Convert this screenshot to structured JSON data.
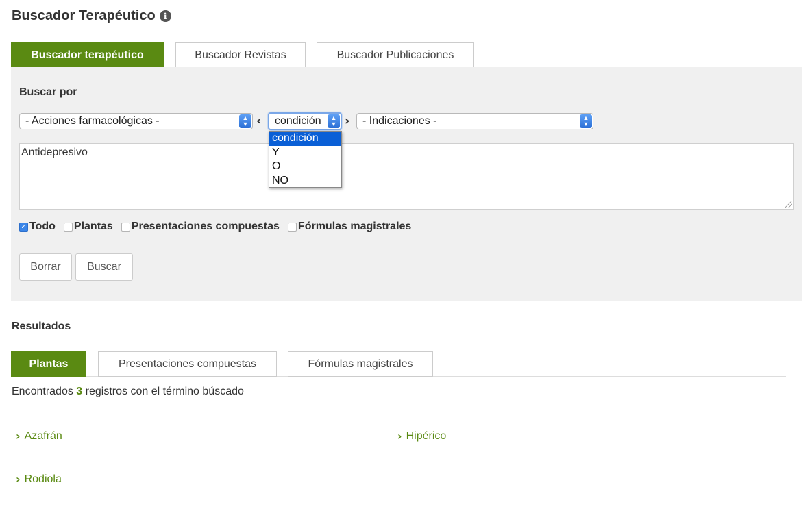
{
  "header": {
    "title": "Buscador Terapéutico",
    "info_icon_glyph": "i"
  },
  "top_tabs": [
    {
      "label": "Buscador terapéutico",
      "active": true
    },
    {
      "label": "Buscador Revistas",
      "active": false
    },
    {
      "label": "Buscador Publicaciones",
      "active": false
    }
  ],
  "search": {
    "label": "Buscar por",
    "select_actions": "- Acciones farmacológicas -",
    "select_condition": "condición",
    "select_indications": "- Indicaciones -",
    "condition_options": [
      "condición",
      "Y",
      "O",
      "NO"
    ],
    "condition_selected_index": 0,
    "query_text": "Antidepresivo",
    "filters": [
      {
        "label": "Todo",
        "checked": true
      },
      {
        "label": "Plantas",
        "checked": false
      },
      {
        "label": "Presentaciones compuestas",
        "checked": false
      },
      {
        "label": "Fórmulas magistrales",
        "checked": false
      }
    ],
    "clear_label": "Borrar",
    "search_label": "Buscar"
  },
  "results": {
    "label": "Resultados",
    "tabs": [
      {
        "label": "Plantas",
        "active": true
      },
      {
        "label": "Presentaciones compuestas",
        "active": false
      },
      {
        "label": "Fórmulas magistrales",
        "active": false
      }
    ],
    "count_prefix": "Encontrados",
    "count": "3",
    "count_suffix": "registros con el término búscado",
    "items": [
      "Azafrán",
      "Hipérico",
      "Rodiola"
    ]
  },
  "colors": {
    "accent": "#5a8a12",
    "select_highlight": "#0a5fd6"
  }
}
